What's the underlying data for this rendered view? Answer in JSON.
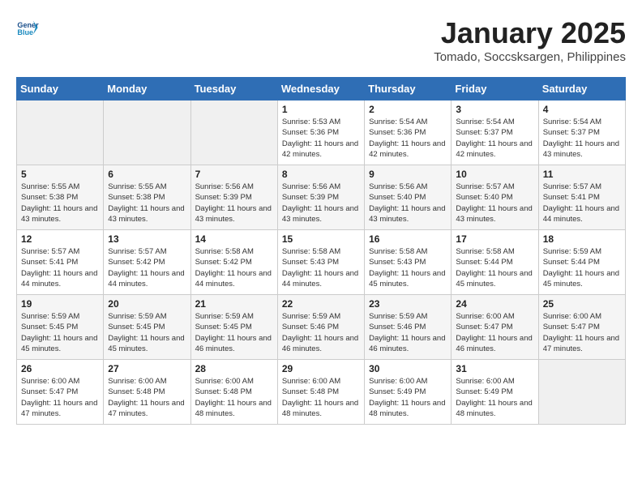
{
  "header": {
    "logo_line1": "General",
    "logo_line2": "Blue",
    "month_title": "January 2025",
    "location": "Tomado, Soccsksargen, Philippines"
  },
  "days_of_week": [
    "Sunday",
    "Monday",
    "Tuesday",
    "Wednesday",
    "Thursday",
    "Friday",
    "Saturday"
  ],
  "weeks": [
    [
      {
        "day": "",
        "info": ""
      },
      {
        "day": "",
        "info": ""
      },
      {
        "day": "",
        "info": ""
      },
      {
        "day": "1",
        "info": "Sunrise: 5:53 AM\nSunset: 5:36 PM\nDaylight: 11 hours and 42 minutes."
      },
      {
        "day": "2",
        "info": "Sunrise: 5:54 AM\nSunset: 5:36 PM\nDaylight: 11 hours and 42 minutes."
      },
      {
        "day": "3",
        "info": "Sunrise: 5:54 AM\nSunset: 5:37 PM\nDaylight: 11 hours and 42 minutes."
      },
      {
        "day": "4",
        "info": "Sunrise: 5:54 AM\nSunset: 5:37 PM\nDaylight: 11 hours and 43 minutes."
      }
    ],
    [
      {
        "day": "5",
        "info": "Sunrise: 5:55 AM\nSunset: 5:38 PM\nDaylight: 11 hours and 43 minutes."
      },
      {
        "day": "6",
        "info": "Sunrise: 5:55 AM\nSunset: 5:38 PM\nDaylight: 11 hours and 43 minutes."
      },
      {
        "day": "7",
        "info": "Sunrise: 5:56 AM\nSunset: 5:39 PM\nDaylight: 11 hours and 43 minutes."
      },
      {
        "day": "8",
        "info": "Sunrise: 5:56 AM\nSunset: 5:39 PM\nDaylight: 11 hours and 43 minutes."
      },
      {
        "day": "9",
        "info": "Sunrise: 5:56 AM\nSunset: 5:40 PM\nDaylight: 11 hours and 43 minutes."
      },
      {
        "day": "10",
        "info": "Sunrise: 5:57 AM\nSunset: 5:40 PM\nDaylight: 11 hours and 43 minutes."
      },
      {
        "day": "11",
        "info": "Sunrise: 5:57 AM\nSunset: 5:41 PM\nDaylight: 11 hours and 44 minutes."
      }
    ],
    [
      {
        "day": "12",
        "info": "Sunrise: 5:57 AM\nSunset: 5:41 PM\nDaylight: 11 hours and 44 minutes."
      },
      {
        "day": "13",
        "info": "Sunrise: 5:57 AM\nSunset: 5:42 PM\nDaylight: 11 hours and 44 minutes."
      },
      {
        "day": "14",
        "info": "Sunrise: 5:58 AM\nSunset: 5:42 PM\nDaylight: 11 hours and 44 minutes."
      },
      {
        "day": "15",
        "info": "Sunrise: 5:58 AM\nSunset: 5:43 PM\nDaylight: 11 hours and 44 minutes."
      },
      {
        "day": "16",
        "info": "Sunrise: 5:58 AM\nSunset: 5:43 PM\nDaylight: 11 hours and 45 minutes."
      },
      {
        "day": "17",
        "info": "Sunrise: 5:58 AM\nSunset: 5:44 PM\nDaylight: 11 hours and 45 minutes."
      },
      {
        "day": "18",
        "info": "Sunrise: 5:59 AM\nSunset: 5:44 PM\nDaylight: 11 hours and 45 minutes."
      }
    ],
    [
      {
        "day": "19",
        "info": "Sunrise: 5:59 AM\nSunset: 5:45 PM\nDaylight: 11 hours and 45 minutes."
      },
      {
        "day": "20",
        "info": "Sunrise: 5:59 AM\nSunset: 5:45 PM\nDaylight: 11 hours and 45 minutes."
      },
      {
        "day": "21",
        "info": "Sunrise: 5:59 AM\nSunset: 5:45 PM\nDaylight: 11 hours and 46 minutes."
      },
      {
        "day": "22",
        "info": "Sunrise: 5:59 AM\nSunset: 5:46 PM\nDaylight: 11 hours and 46 minutes."
      },
      {
        "day": "23",
        "info": "Sunrise: 5:59 AM\nSunset: 5:46 PM\nDaylight: 11 hours and 46 minutes."
      },
      {
        "day": "24",
        "info": "Sunrise: 6:00 AM\nSunset: 5:47 PM\nDaylight: 11 hours and 46 minutes."
      },
      {
        "day": "25",
        "info": "Sunrise: 6:00 AM\nSunset: 5:47 PM\nDaylight: 11 hours and 47 minutes."
      }
    ],
    [
      {
        "day": "26",
        "info": "Sunrise: 6:00 AM\nSunset: 5:47 PM\nDaylight: 11 hours and 47 minutes."
      },
      {
        "day": "27",
        "info": "Sunrise: 6:00 AM\nSunset: 5:48 PM\nDaylight: 11 hours and 47 minutes."
      },
      {
        "day": "28",
        "info": "Sunrise: 6:00 AM\nSunset: 5:48 PM\nDaylight: 11 hours and 48 minutes."
      },
      {
        "day": "29",
        "info": "Sunrise: 6:00 AM\nSunset: 5:48 PM\nDaylight: 11 hours and 48 minutes."
      },
      {
        "day": "30",
        "info": "Sunrise: 6:00 AM\nSunset: 5:49 PM\nDaylight: 11 hours and 48 minutes."
      },
      {
        "day": "31",
        "info": "Sunrise: 6:00 AM\nSunset: 5:49 PM\nDaylight: 11 hours and 48 minutes."
      },
      {
        "day": "",
        "info": ""
      }
    ]
  ]
}
